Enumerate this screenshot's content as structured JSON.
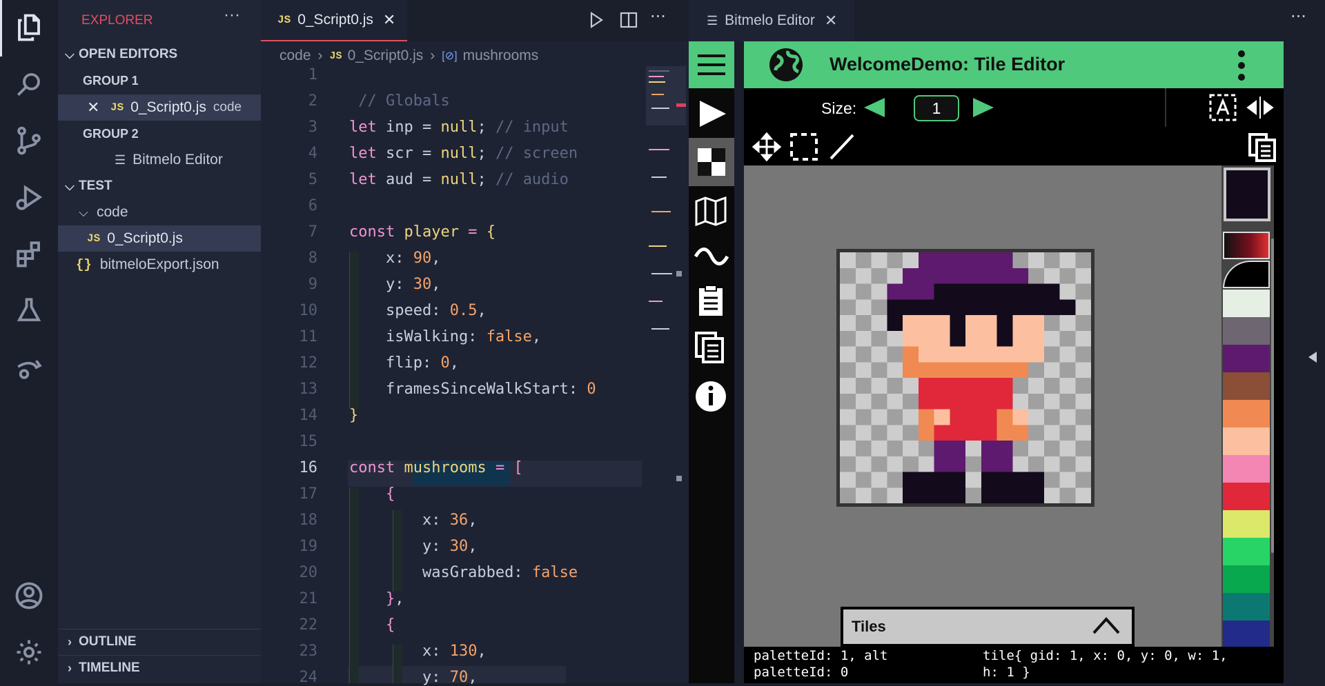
{
  "sidebar": {
    "title": "EXPLORER",
    "more": "···",
    "open_editors": "OPEN EDITORS",
    "group1": "GROUP 1",
    "group1_file": "0_Script0.js",
    "group1_file_folder": "code",
    "group2": "GROUP 2",
    "group2_file": "Bitmelo Editor",
    "workspace": "TEST",
    "folder": "code",
    "file1": "0_Script0.js",
    "file2": "bitmeloExport.json",
    "outline": "OUTLINE",
    "timeline": "TIMELINE"
  },
  "editor": {
    "tab_label": "0_Script0.js",
    "breadcrumb": [
      "code",
      "0_Script0.js",
      "mushrooms"
    ],
    "current_line": "16"
  },
  "bitmelo": {
    "tab_label": "Bitmelo Editor",
    "title": "WelcomeDemo: Tile Editor",
    "size_label": "Size:",
    "size_value": "1",
    "tiles_label": "Tiles",
    "status_left_1": "paletteId: 1, alt",
    "status_left_2": "paletteId: 0",
    "status_right_1": "tile{ gid: 1, x: 0, y: 0, w: 1,",
    "status_right_2": "h: 1 }"
  },
  "colors": {
    "accent_green": "#4fc97c",
    "explorer_title": "#e04f5f",
    "palette": [
      "#e6efe4",
      "#6e6670",
      "#5e1a6e",
      "#8a4f36",
      "#f08a52",
      "#fcc0a0",
      "#f486b4",
      "#e0283a",
      "#dbe86a",
      "#28d466",
      "#08a84e",
      "#0c7872",
      "#222a8a"
    ]
  },
  "icons": [
    "files-icon",
    "search-icon",
    "source-control-icon",
    "run-debug-icon",
    "extensions-icon",
    "testing-icon",
    "remote-icon",
    "account-icon",
    "settings-icon"
  ]
}
